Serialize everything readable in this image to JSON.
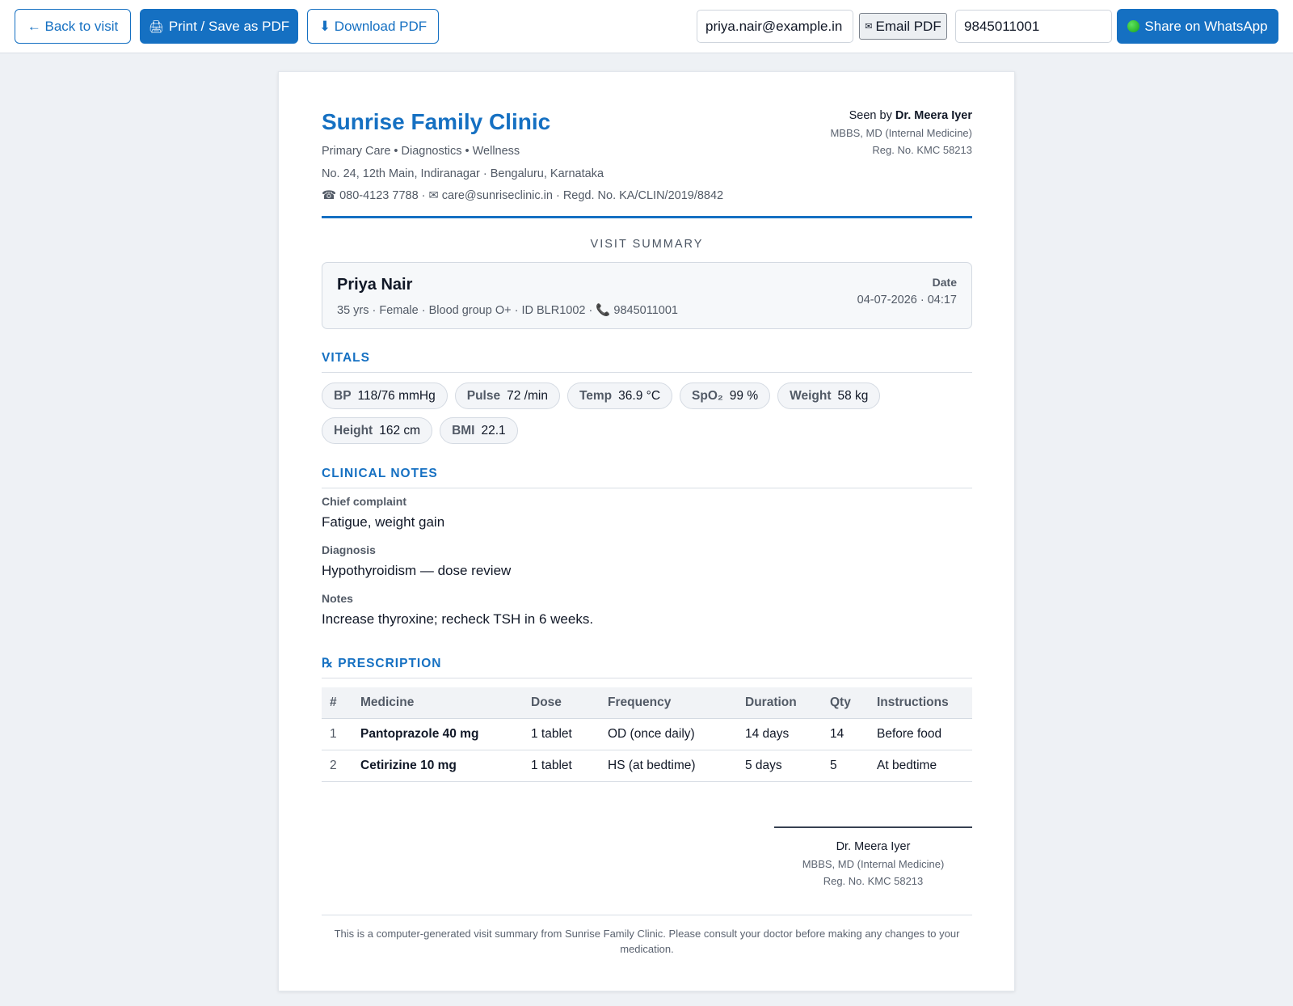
{
  "toolbar": {
    "back_label": "← Back to visit",
    "print_icon": "printer-icon",
    "print_label": "Print / Save as PDF",
    "download_label": "⬇ Download PDF",
    "email_value": "priya.nair@example.in",
    "email_button_label": "Email PDF",
    "phone_value": "9845011001",
    "whatsapp_icon": "whatsapp-dot-icon",
    "whatsapp_label": "Share on WhatsApp",
    "accent_color": "#1570c2"
  },
  "clinic": {
    "name": "Sunrise Family Clinic",
    "tagline": "Primary Care • Diagnostics • Wellness",
    "address": "No. 24, 12th Main, Indiranagar · Bengaluru, Karnataka",
    "contact": "☎ 080-4123 7788 · ✉ care@sunriseclinic.in · Regd. No. KA/CLIN/2019/8842"
  },
  "doctor": {
    "seen_by_prefix": "Seen by",
    "name": "Dr. Meera Iyer",
    "qualification": "MBBS, MD (Internal Medicine)",
    "registration": "Reg. No. KMC 58213"
  },
  "visit_title": "VISIT SUMMARY",
  "patient": {
    "name": "Priya Nair",
    "meta": "35 yrs · Female · Blood group O+ · ID BLR1002 · 📞 9845011001",
    "date_label": "Date",
    "date_value": "04-07-2026 · 04:17"
  },
  "sections": {
    "vitals": "VITALS",
    "notes": "CLINICAL NOTES",
    "prescription": "℞ PRESCRIPTION"
  },
  "vitals": [
    {
      "label": "BP",
      "value": "118/76 mmHg"
    },
    {
      "label": "Pulse",
      "value": "72 /min"
    },
    {
      "label": "Temp",
      "value": "36.9 °C"
    },
    {
      "label": "SpO₂",
      "value": "99 %"
    },
    {
      "label": "Weight",
      "value": "58 kg"
    },
    {
      "label": "Height",
      "value": "162 cm"
    },
    {
      "label": "BMI",
      "value": "22.1"
    }
  ],
  "notes": {
    "chief_complaint_label": "Chief complaint",
    "chief_complaint": "Fatigue, weight gain",
    "diagnosis_label": "Diagnosis",
    "diagnosis": "Hypothyroidism — dose review",
    "notes_label": "Notes",
    "notes": "Increase thyroxine; recheck TSH in 6 weeks."
  },
  "prescription": {
    "headers": [
      "#",
      "Medicine",
      "Dose",
      "Frequency",
      "Duration",
      "Qty",
      "Instructions"
    ],
    "rows": [
      [
        "1",
        "Pantoprazole 40 mg",
        "1 tablet",
        "OD (once daily)",
        "14 days",
        "14",
        "Before food"
      ],
      [
        "2",
        "Cetirizine 10 mg",
        "1 tablet",
        "HS (at bedtime)",
        "5 days",
        "5",
        "At bedtime"
      ]
    ]
  },
  "signature": {
    "name": "Dr. Meera Iyer",
    "qualification": "MBBS, MD (Internal Medicine)",
    "registration": "Reg. No. KMC 58213"
  },
  "footer": "This is a computer-generated visit summary from Sunrise Family Clinic. Please consult your doctor before making any changes to your medication."
}
